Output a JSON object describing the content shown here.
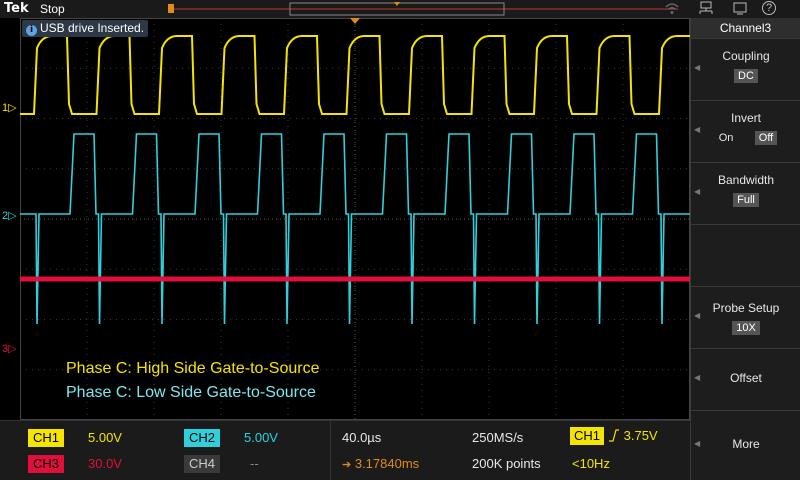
{
  "header": {
    "brand": "Tek",
    "run_state": "Stop"
  },
  "notification": {
    "text": "USB drive Inserted."
  },
  "channel_markers": {
    "ch1": "1",
    "ch2": "2",
    "ch3": "3"
  },
  "annotations": {
    "line1": "Phase C: High Side Gate-to-Source",
    "line2": "Phase C: Low Side Gate-to-Source"
  },
  "status": {
    "ch1": {
      "label": "CH1",
      "scale": "5.00V",
      "color": "#f5e400"
    },
    "ch2": {
      "label": "CH2",
      "scale": "5.00V",
      "color": "#2fd0dc"
    },
    "ch3": {
      "label": "CH3",
      "scale": "30.0V",
      "color": "#e0103a"
    },
    "ch4": {
      "label": "CH4",
      "scale": "--",
      "color": "#b0b0b0"
    },
    "horizontal_scale": "40.0µs",
    "sample_rate": "250MS/s",
    "record_length": "200K points",
    "trigger_delay": "3.17840ms",
    "trigger_source": "CH1",
    "trigger_level": "3.75V",
    "trigger_frequency": "<10Hz"
  },
  "side_menu": {
    "title": "Channel3",
    "coupling": {
      "label": "Coupling",
      "value": "DC"
    },
    "invert": {
      "label": "Invert",
      "on": "On",
      "off": "Off",
      "selected": "Off"
    },
    "bandwidth": {
      "label": "Bandwidth",
      "value": "Full"
    },
    "probe_setup": {
      "label": "Probe Setup",
      "value": "10X"
    },
    "offset": {
      "label": "Offset"
    },
    "more": {
      "label": "More"
    }
  },
  "top_icons": {
    "help": "?"
  }
}
